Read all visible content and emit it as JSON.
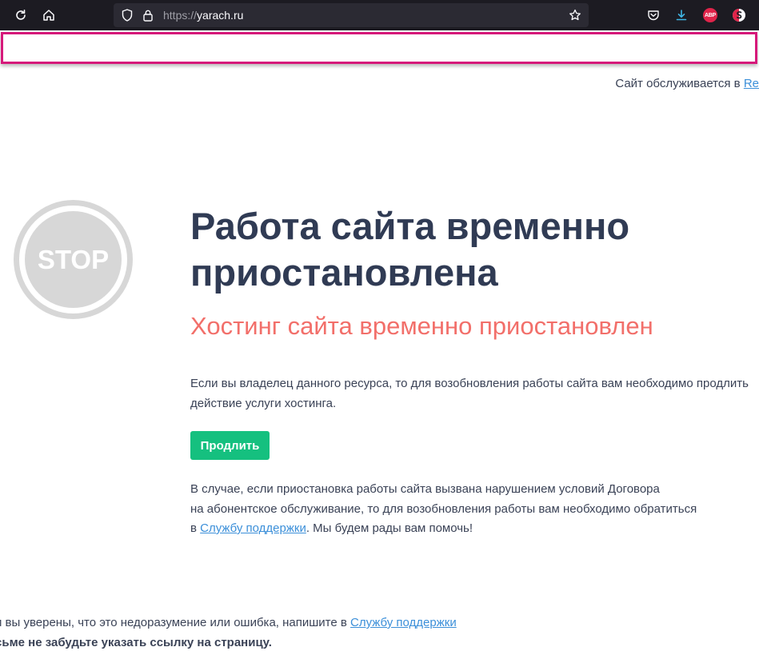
{
  "browser": {
    "url_protocol": "https://",
    "url_host": "yarach.ru",
    "extensions": {
      "abp_label": "ABP"
    }
  },
  "page": {
    "served_prefix": "Сайт обслуживается в",
    "served_link": "Re",
    "stop_label": "STOP",
    "headline": "Работа сайта временно приостановлена",
    "subheadline": "Хостинг сайта временно приостановлен",
    "paragraph1": "Если вы владелец данного ресурса, то для возобновления работы сайта вам необходимо продлить действие услуги хостинга.",
    "renew_button": "Продлить",
    "paragraph2_line1": "В случае, если приостановка работы сайта вызвана нарушением условий Договора",
    "paragraph2_line2": "на абонентское обслуживание, то для возобновления работы вам необходимо обратиться",
    "paragraph2_prefix": "в",
    "support_link": "Службу поддержки",
    "paragraph2_suffix": ". Мы будем рады вам помочь!",
    "footer_line1": "и вы уверены, что это недоразумение или ошибка, напишите в",
    "footer_support_link": "Службу поддержки",
    "footer_line2": "сьме не забудьте указать ссылку на страницу."
  },
  "colors": {
    "headline": "#303b54",
    "subheadline": "#f26f6a",
    "button": "#15c07f",
    "link": "#3b8fd9",
    "frame": "#d6197a"
  }
}
